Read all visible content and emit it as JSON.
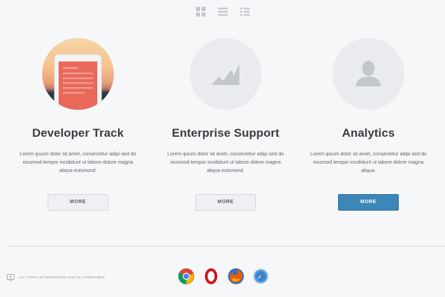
{
  "view_toggles": [
    "grid-view-icon",
    "list-view-icon",
    "detail-list-view-icon"
  ],
  "cards": [
    {
      "title": "Developer Track",
      "description": "Lorem ipsum dolor sit amet, consectetur adipi sed do eiusmod tempor incididunt ut labore dolore magna aliqua euismond.",
      "button": "MORE",
      "icon": "tablet-document-icon"
    },
    {
      "title": "Enterprise Support",
      "description": "Lorem ipsum dolor sit amet, consectetur adipi sed do eiusmod tempor incididunt ut labore dolore magna aliqua euismond.",
      "button": "MORE",
      "icon": "area-chart-icon"
    },
    {
      "title": "Analytics",
      "description": "Lorem ipsum dolor sit amet, consectetur adipi sed do eiusmod tempor incididunt ut labore dolore magna aliqua.",
      "button": "MORE",
      "icon": "user-silhouette-icon"
    }
  ],
  "footer": {
    "compat_text": "ALL TYPES OF BROWSERS AND OS COMPATIBLE",
    "browsers": [
      "chrome-icon",
      "opera-icon",
      "firefox-icon",
      "safari-icon"
    ]
  },
  "colors": {
    "primary_button": "#3d87b8",
    "background": "#f6f7f9",
    "circle_placeholder": "#e9ebee",
    "document_card": "#e8685a"
  }
}
